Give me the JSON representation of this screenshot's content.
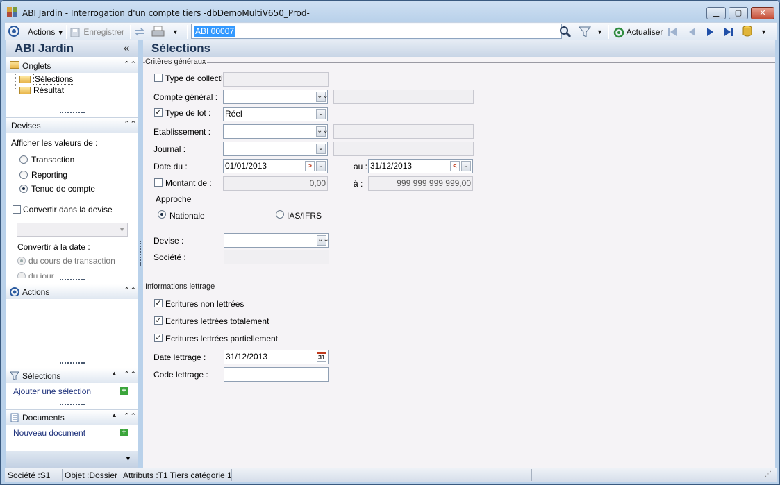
{
  "window": {
    "title": "ABI Jardin - Interrogation d'un compte tiers -dbDemoMultiV650_Prod-",
    "minimize": "▁",
    "maximize": "▢",
    "close": "✕"
  },
  "toolbar": {
    "actions_label": "Actions",
    "save_label": "Enregistrer",
    "search_value": "ABI 00007",
    "refresh_label": "Actualiser"
  },
  "sidebar": {
    "title": "ABI Jardin",
    "onglets": {
      "label": "Onglets",
      "items": [
        {
          "label": "Sélections"
        },
        {
          "label": "Résultat"
        }
      ]
    },
    "devises": {
      "label": "Devises",
      "display_values_label": "Afficher les valeurs de :",
      "options": [
        {
          "label": "Transaction",
          "selected": false
        },
        {
          "label": "Reporting",
          "selected": false
        },
        {
          "label": "Tenue de compte",
          "selected": true
        }
      ],
      "convert_label": "Convertir dans la devise",
      "convert_checked": false,
      "convert_currency": "",
      "convert_date_label": "Convertir à la date :",
      "date_options": [
        {
          "label": "du cours de transaction",
          "selected": true
        },
        {
          "label": "du jour",
          "selected": false
        }
      ]
    },
    "actions": {
      "label": "Actions"
    },
    "selections": {
      "label": "Sélections",
      "add_link": "Ajouter une sélection"
    },
    "documents": {
      "label": "Documents",
      "new_link": "Nouveau document"
    }
  },
  "main": {
    "title": "Sélections",
    "criteria": {
      "group_label": "Critères généraux",
      "type_collectif": {
        "label": "Type de collectif",
        "checked": false,
        "value": ""
      },
      "compte_general": {
        "label": "Compte général :",
        "value": "",
        "desc": ""
      },
      "type_lot": {
        "label": "Type de lot :",
        "checked": true,
        "value": "Réel"
      },
      "etablissement": {
        "label": "Etablissement :",
        "value": "",
        "desc": ""
      },
      "journal": {
        "label": "Journal :",
        "value": "",
        "desc": ""
      },
      "date_du": {
        "label": "Date du :",
        "value": "01/01/2013"
      },
      "date_au": {
        "label": "au :",
        "value": "31/12/2013"
      },
      "montant": {
        "label": "Montant de :",
        "checked": false,
        "from": "0,00",
        "to_label": "à :",
        "to": "999 999 999 999,00"
      },
      "approche": {
        "label": "Approche",
        "options": [
          {
            "label": "Nationale",
            "selected": true
          },
          {
            "label": "IAS/IFRS",
            "selected": false
          }
        ]
      },
      "devise": {
        "label": "Devise :",
        "value": ""
      },
      "societe": {
        "label": "Société :",
        "value": ""
      }
    },
    "lettrage": {
      "group_label": "Informations lettrage",
      "checks": [
        {
          "label": "Ecritures non lettrées",
          "checked": true
        },
        {
          "label": "Ecritures lettrées totalement",
          "checked": true
        },
        {
          "label": "Ecritures lettrées partiellement",
          "checked": true
        }
      ],
      "date_lettrage": {
        "label": "Date lettrage :",
        "value": "31/12/2013",
        "cal": "31"
      },
      "code_lettrage": {
        "label": "Code lettrage :",
        "value": ""
      }
    }
  },
  "statusbar": {
    "societe": "Société :S1",
    "objet": "Objet :Dossier",
    "attributs": "Attributs :T1 Tiers catégorie 1"
  }
}
